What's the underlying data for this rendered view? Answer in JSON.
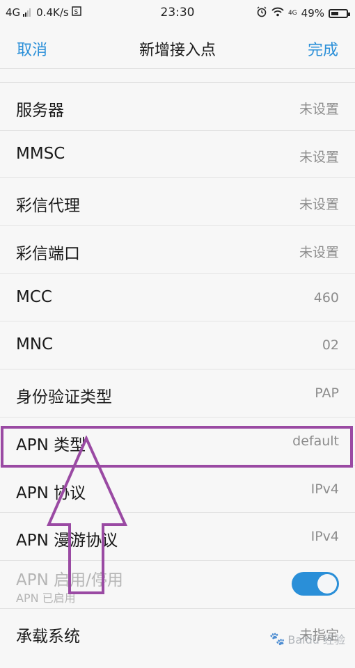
{
  "status_bar": {
    "network_left": "4G",
    "speed": "0.4K/s",
    "sim_icon": "sim-icon",
    "time": "23:30",
    "alarm_icon": "alarm-icon",
    "wifi_icon": "wifi-icon",
    "network_right": "4G",
    "battery_percent": "49%",
    "battery_level": 0.49
  },
  "nav": {
    "cancel": "取消",
    "title": "新增接入点",
    "done": "完成"
  },
  "rows": [
    {
      "label": "服务器",
      "value": "未设置"
    },
    {
      "label": "MMSC",
      "value": "未设置"
    },
    {
      "label": "彩信代理",
      "value": "未设置"
    },
    {
      "label": "彩信端口",
      "value": "未设置"
    },
    {
      "label": "MCC",
      "value": "460"
    },
    {
      "label": "MNC",
      "value": "02"
    },
    {
      "label": "身份验证类型",
      "value": "PAP"
    },
    {
      "label": "APN 类型",
      "value": "default"
    },
    {
      "label": "APN 协议",
      "value": "IPv4"
    },
    {
      "label": "APN 漫游协议",
      "value": "IPv4"
    }
  ],
  "toggle_row": {
    "label": "APN 启用/停用",
    "sublabel": "APN 已启用",
    "enabled": true
  },
  "bearer_row": {
    "label": "承载系统",
    "value": "未指定"
  },
  "annotation": {
    "color": "#9a4aa3"
  },
  "watermark": {
    "text": "Baidu 经验"
  }
}
